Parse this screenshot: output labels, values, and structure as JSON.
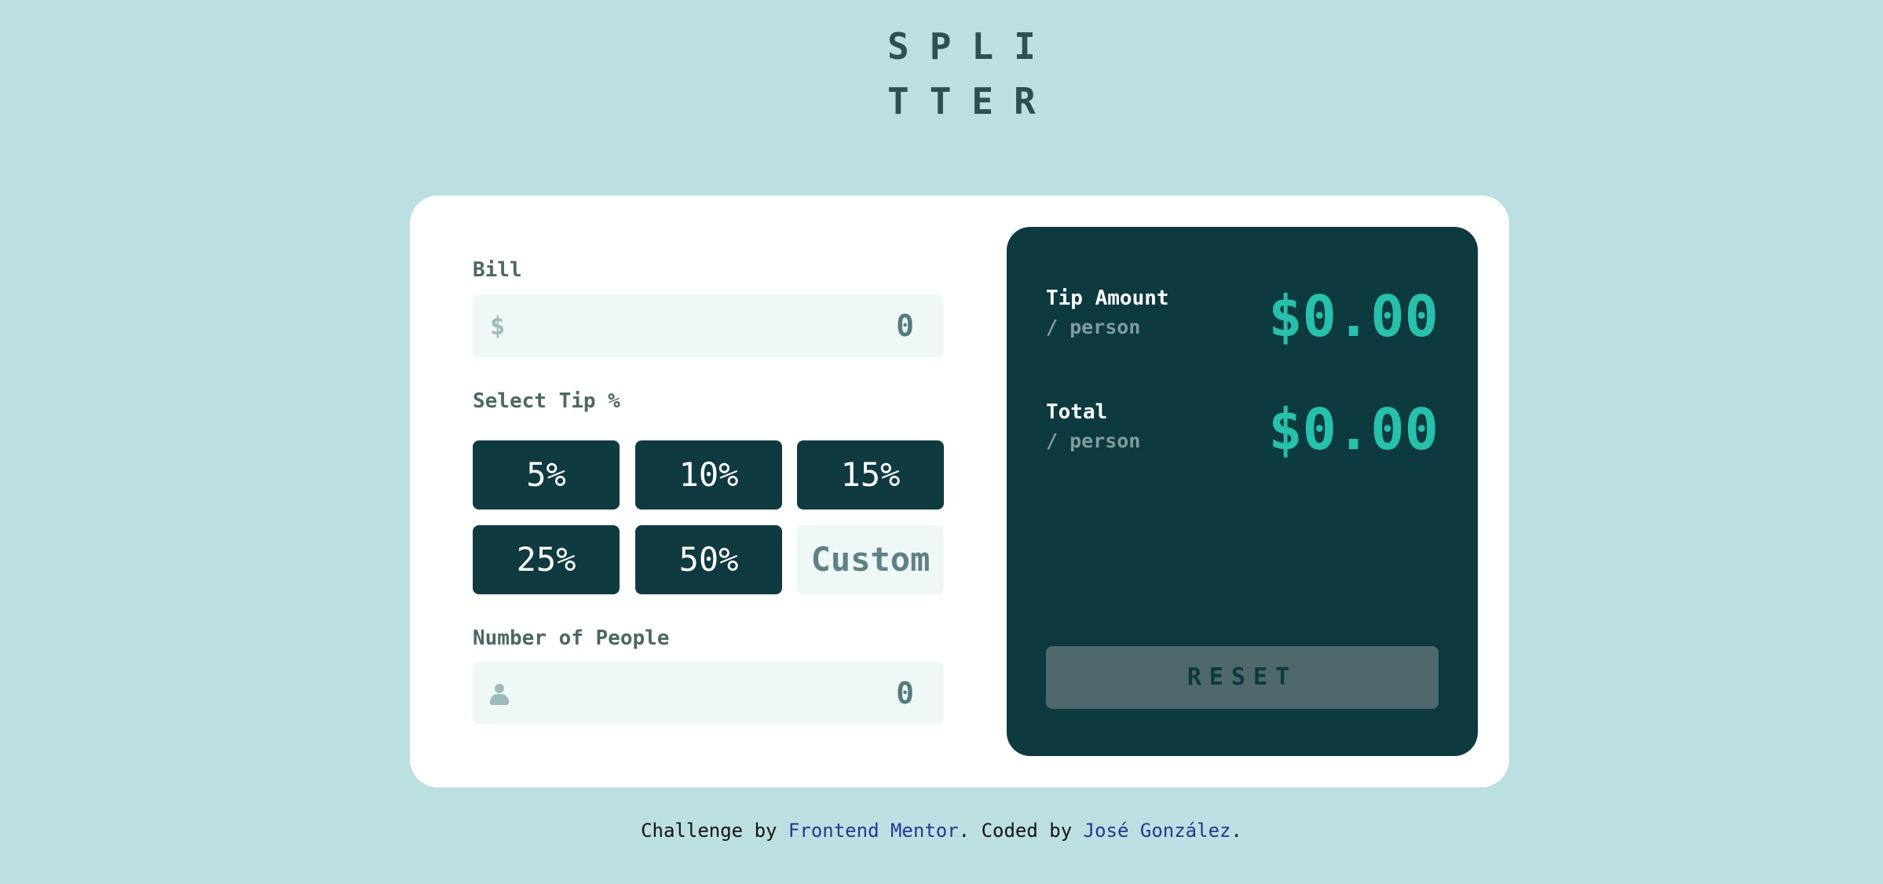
{
  "logo": {
    "line1": "SPLI",
    "line2": "TTER"
  },
  "bill": {
    "label": "Bill",
    "currency_symbol": "$",
    "value": "0"
  },
  "tip": {
    "label": "Select Tip %",
    "options": [
      "5%",
      "10%",
      "15%",
      "25%",
      "50%"
    ],
    "custom_placeholder": "Custom"
  },
  "people": {
    "label": "Number of People",
    "icon": "person-icon",
    "value": "0"
  },
  "results": {
    "tip_amount_label": "Tip Amount",
    "tip_amount_sub": "/ person",
    "tip_amount_value": "$0.00",
    "total_label": "Total",
    "total_sub": "/ person",
    "total_value": "$0.00",
    "reset_label": "RESET"
  },
  "footer": {
    "prefix": "Challenge by ",
    "link1": "Frontend Mentor",
    "middle": ". Coded by ",
    "link2": "José González",
    "suffix": "."
  },
  "colors": {
    "background": "#bcdfe1",
    "card": "#ffffff",
    "dark_panel": "#0d3a3f",
    "accent": "#26c0ab",
    "input_bg": "#f0f8f7"
  }
}
